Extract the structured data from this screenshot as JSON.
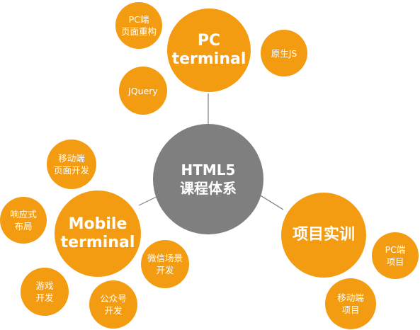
{
  "diagram": {
    "center": {
      "label": "HTML5\n课程体系",
      "color": "#7F7F7F"
    },
    "accent_color": "#F39C12",
    "connector_color": "#7F7F7F",
    "hubs": {
      "pc": "PC\nterminal",
      "mobile": "Mobile\nterminal",
      "project": "项目实训"
    },
    "leaves": {
      "pc_page_rebuild": "PC端\n页面重构",
      "native_js": "原生JS",
      "jquery": "JQuery",
      "mobile_page_dev": "移动端\n页面开发",
      "responsive_layout": "响应式\n布局",
      "wechat_scene_dev": "微信场景\n开发",
      "game_dev": "游戏\n开发",
      "official_account_dev": "公众号\n开发",
      "pc_project": "PC端\n项目",
      "mobile_project": "移动端\n项目"
    }
  }
}
